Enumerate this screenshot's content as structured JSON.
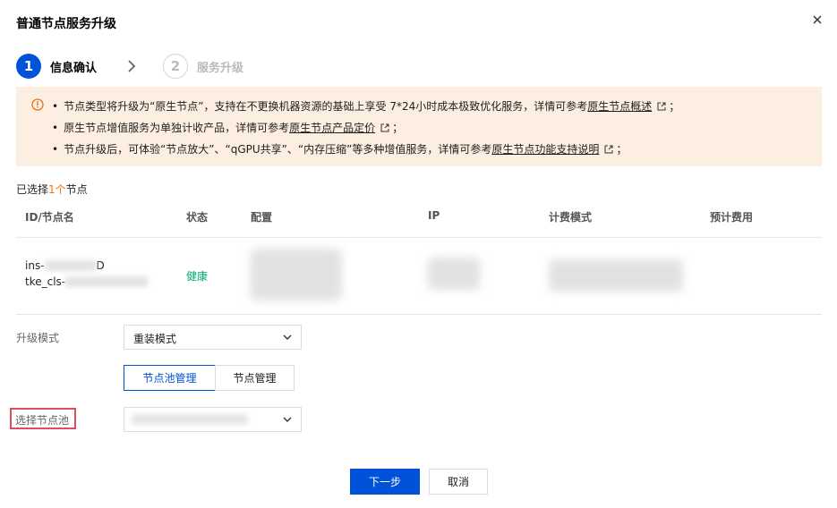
{
  "dialog": {
    "title": "普通节点服务升级"
  },
  "steps": [
    {
      "number": "1",
      "label": "信息确认"
    },
    {
      "number": "2",
      "label": "服务升级"
    }
  ],
  "alert": {
    "lines": [
      {
        "bullet": "•",
        "text": "节点类型将升级为“原生节点”，支持在不更换机器资源的基础上享受 7*24小时成本极致优化服务，详情可参考",
        "link": "原生节点概述",
        "suffix": "；"
      },
      {
        "bullet": "•",
        "text": "原生节点增值服务为单独计收产品，详情可参考",
        "link": "原生节点产品定价",
        "suffix": "；"
      },
      {
        "bullet": "•",
        "text": "节点升级后，可体验“节点放大”、“qGPU共享”、“内存压缩”等多种增值服务，详情可参考",
        "link": "原生节点功能支持说明",
        "suffix": "；"
      }
    ]
  },
  "selection": {
    "prefix": "已选择",
    "count": "1个",
    "suffix": "节点"
  },
  "table": {
    "columns": [
      "ID/节点名",
      "状态",
      "配置",
      "IP",
      "计费模式",
      "预计费用"
    ],
    "rows": [
      {
        "id": "ins-",
        "id_tail": "D",
        "name": "tke_cls-",
        "status": "健康"
      }
    ]
  },
  "form": {
    "upgrade_mode": {
      "label": "升级模式",
      "value": "重装模式"
    },
    "tabs": [
      {
        "label": "节点池管理"
      },
      {
        "label": "节点管理"
      }
    ],
    "node_pool": {
      "label": "选择节点池",
      "value": ""
    }
  },
  "footer": {
    "next_label": "下一步",
    "cancel_label": "取消"
  },
  "colors": {
    "primary": "#0052d9",
    "success": "#00a870",
    "warning_bg": "#fdeee2",
    "highlight": "#ff7200",
    "error": "#e34d59"
  }
}
